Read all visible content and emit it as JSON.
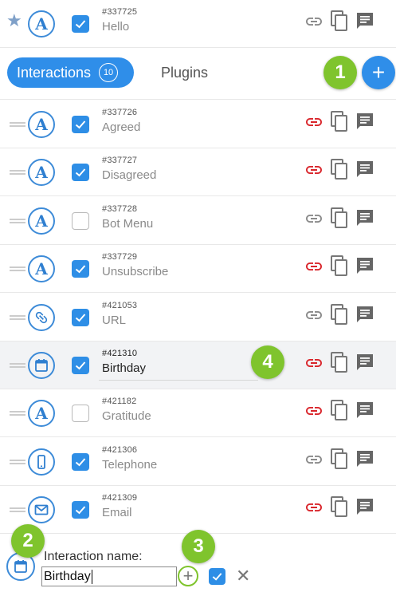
{
  "top_row": {
    "id": "#337725",
    "name": "Hello",
    "checked": true,
    "type_icon": "text-icon",
    "link_color": "gray"
  },
  "tabs": {
    "interactions_label": "Interactions",
    "interactions_count": "10",
    "plugins_label": "Plugins",
    "add_label": "+"
  },
  "badges": {
    "b1": "1",
    "b2": "2",
    "b3": "3",
    "b4": "4"
  },
  "rows": [
    {
      "id": "#337726",
      "name": "Agreed",
      "checked": true,
      "type_icon": "text-icon",
      "link_color": "red"
    },
    {
      "id": "#337727",
      "name": "Disagreed",
      "checked": true,
      "type_icon": "text-icon",
      "link_color": "red"
    },
    {
      "id": "#337728",
      "name": "Bot Menu",
      "checked": false,
      "type_icon": "text-icon",
      "link_color": "gray"
    },
    {
      "id": "#337729",
      "name": "Unsubscribe",
      "checked": true,
      "type_icon": "text-icon",
      "link_color": "red"
    },
    {
      "id": "#421053",
      "name": "URL",
      "checked": true,
      "type_icon": "link-icon",
      "link_color": "gray"
    },
    {
      "id": "#421310",
      "name": "Birthday",
      "checked": true,
      "type_icon": "calendar-icon",
      "link_color": "red"
    },
    {
      "id": "#421182",
      "name": "Gratitude",
      "checked": false,
      "type_icon": "text-icon",
      "link_color": "red"
    },
    {
      "id": "#421306",
      "name": "Telephone",
      "checked": true,
      "type_icon": "phone-icon",
      "link_color": "gray"
    },
    {
      "id": "#421309",
      "name": "Email",
      "checked": true,
      "type_icon": "mail-icon",
      "link_color": "red"
    }
  ],
  "new_interaction": {
    "label": "Interaction name:",
    "value": "Birthday",
    "plus": "+",
    "cancel": "✕"
  },
  "colors": {
    "accent": "#2f8ee9",
    "badge": "#7fc42d",
    "link_red": "#d9252b",
    "link_gray": "#8a8a8a",
    "icon_blue": "#3d8bd8"
  }
}
